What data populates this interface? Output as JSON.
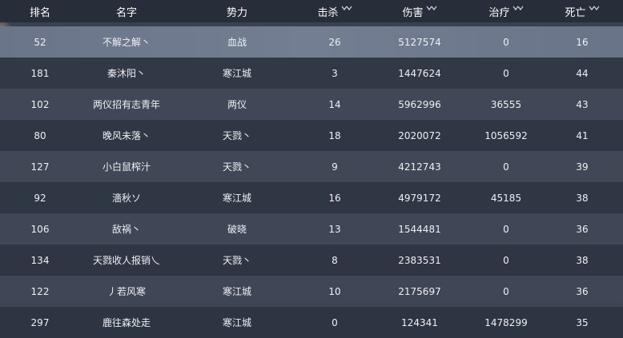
{
  "headers": {
    "rank": "排名",
    "name": "名字",
    "faction": "势力",
    "kills": "击杀",
    "damage": "伤害",
    "healing": "治疗",
    "deaths": "死亡"
  },
  "icons": {
    "sort": "sort-chevron-icon"
  },
  "colors": {
    "header_bg": "#262c38",
    "selected_row": "#6f798d",
    "alt_row": "#4e5667",
    "text": "#eef0f4"
  },
  "rows": [
    {
      "rank": "52",
      "name": "不解之解丶",
      "faction": "血战",
      "kills": "26",
      "damage": "5127574",
      "healing": "0",
      "deaths": "16"
    },
    {
      "rank": "181",
      "name": "秦沐阳丶",
      "faction": "寒江城",
      "kills": "3",
      "damage": "1447624",
      "healing": "0",
      "deaths": "44"
    },
    {
      "rank": "102",
      "name": "两仪招有志青年",
      "faction": "两仪",
      "kills": "14",
      "damage": "5962996",
      "healing": "36555",
      "deaths": "43"
    },
    {
      "rank": "80",
      "name": "晚风未落丶",
      "faction": "天戮丶",
      "kills": "18",
      "damage": "2020072",
      "healing": "1056592",
      "deaths": "41"
    },
    {
      "rank": "127",
      "name": "小白鼠榨汁",
      "faction": "天戮丶",
      "kills": "9",
      "damage": "4212743",
      "healing": "0",
      "deaths": "39"
    },
    {
      "rank": "92",
      "name": "濇秋ソ",
      "faction": "寒江城",
      "kills": "16",
      "damage": "4979172",
      "healing": "45185",
      "deaths": "38"
    },
    {
      "rank": "106",
      "name": "敌祸丶",
      "faction": "破晓",
      "kills": "13",
      "damage": "1544481",
      "healing": "0",
      "deaths": "36"
    },
    {
      "rank": "134",
      "name": "天戮收人报销乀",
      "faction": "天戮丶",
      "kills": "8",
      "damage": "2383531",
      "healing": "0",
      "deaths": "38"
    },
    {
      "rank": "122",
      "name": "丿若风寒",
      "faction": "寒江城",
      "kills": "10",
      "damage": "2175697",
      "healing": "0",
      "deaths": "36"
    },
    {
      "rank": "297",
      "name": "鹿往森处走",
      "faction": "寒江城",
      "kills": "0",
      "damage": "124341",
      "healing": "1478299",
      "deaths": "35"
    }
  ]
}
